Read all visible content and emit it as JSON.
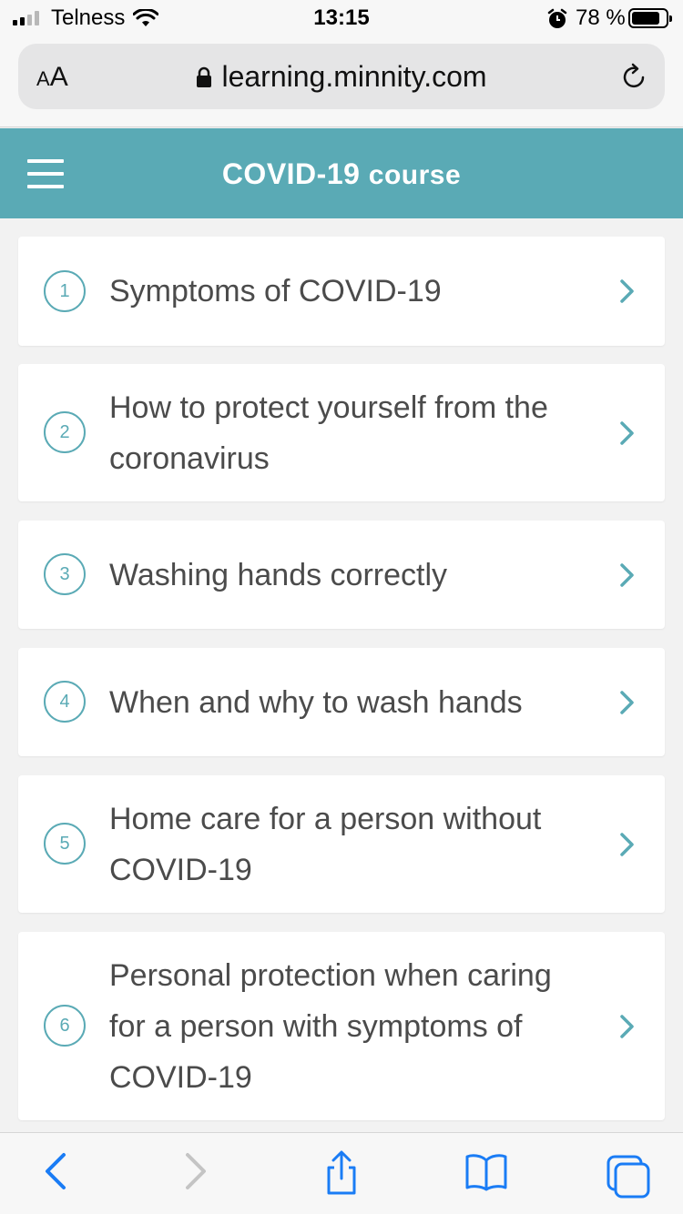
{
  "status_bar": {
    "carrier": "Telness",
    "time": "13:15",
    "battery": "78 %"
  },
  "browser": {
    "text_size_small": "A",
    "text_size_big": "A",
    "url": "learning.minnity.com"
  },
  "header": {
    "title_main": "COVID-19",
    "title_sub": "course"
  },
  "lessons": [
    {
      "number": "1",
      "title": "Symptoms of COVID-19"
    },
    {
      "number": "2",
      "title": "How to protect yourself from the coronavirus"
    },
    {
      "number": "3",
      "title": "Washing hands correctly"
    },
    {
      "number": "4",
      "title": "When and why to wash hands"
    },
    {
      "number": "5",
      "title": "Home care for a person without COVID-19"
    },
    {
      "number": "6",
      "title": "Personal protection when caring for a person with symptoms of COVID-19"
    }
  ],
  "colors": {
    "accent": "#5aaab5",
    "ios_blue": "#1a7cf5"
  },
  "icons": [
    "signal-icon",
    "wifi-icon",
    "alarm-icon",
    "battery-icon",
    "lock-icon",
    "reload-icon",
    "hamburger-icon",
    "chevron-right-icon",
    "back-icon",
    "forward-icon",
    "share-icon",
    "bookmarks-icon",
    "tabs-icon"
  ]
}
